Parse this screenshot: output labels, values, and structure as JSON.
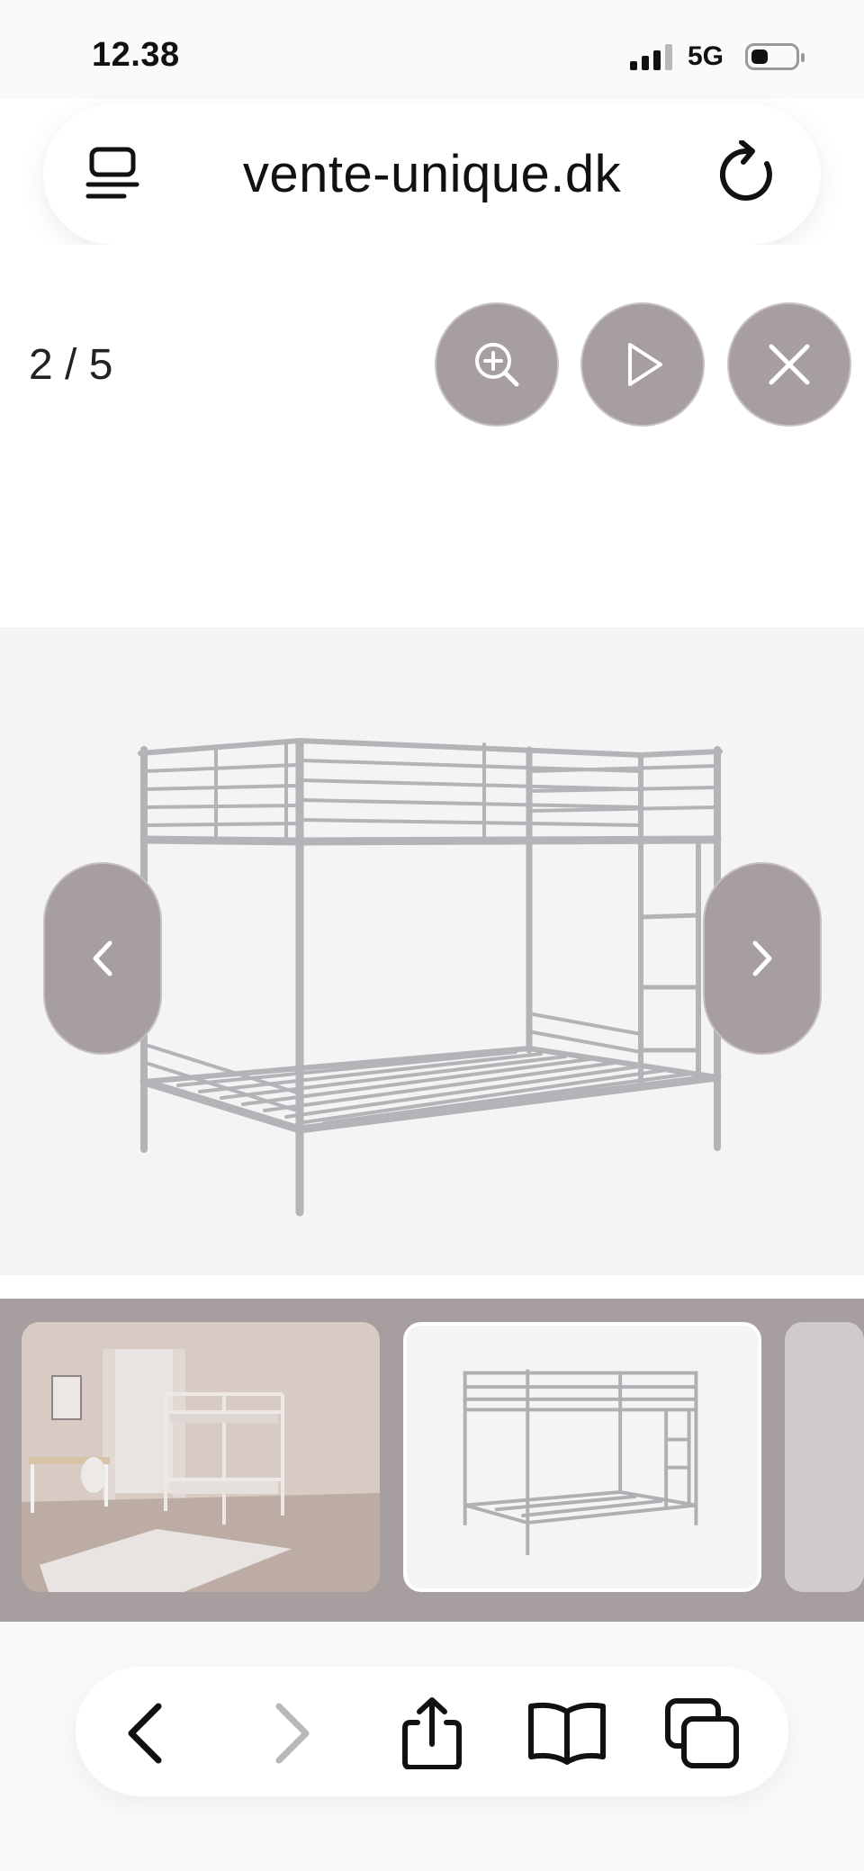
{
  "status_bar": {
    "time": "12.38",
    "network": "5G"
  },
  "browser": {
    "url": "vente-unique.dk",
    "reader_icon": "reader-mode-icon",
    "reload_icon": "reload-icon"
  },
  "lightbox": {
    "counter": "2 / 5",
    "current_index": 2,
    "total": 5,
    "buttons": [
      "zoom-in-icon",
      "play-icon",
      "close-icon"
    ],
    "prev_icon": "chevron-left-icon",
    "next_icon": "chevron-right-icon",
    "thumbnails": [
      "room-scene-bunk-bed",
      "bunk-bed-product-photo",
      "partial-thumbnail"
    ],
    "selected_thumbnail": 1
  },
  "toolbar": {
    "items": [
      "back-icon",
      "forward-icon",
      "share-icon",
      "bookmarks-icon",
      "tabs-icon"
    ]
  },
  "colors": {
    "overlay_button": "#a69e9f",
    "thumb_strip": "#a69e9f",
    "image_background": "#f4f4f4",
    "bed_frame": "#b4b4b8"
  }
}
